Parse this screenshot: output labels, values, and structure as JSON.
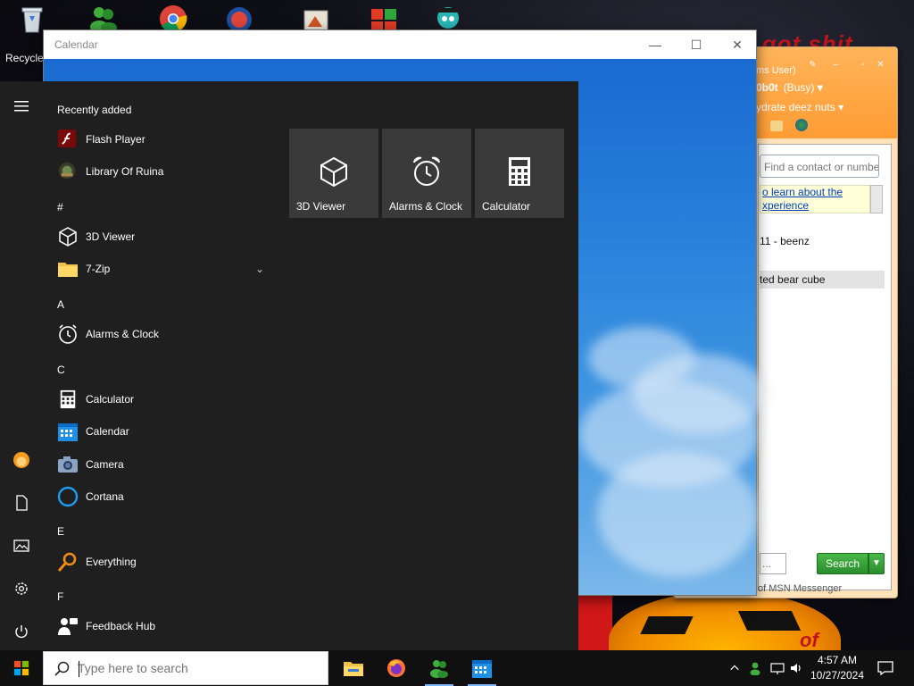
{
  "desktop": {
    "recycle_bin_label": "Recycle",
    "graffiti_text": "e got shit",
    "wallpaper_text": "of"
  },
  "msn": {
    "user_line": "ms User)",
    "name": "0b0t",
    "status": "(Busy)",
    "psm": "ydrate deez nuts",
    "search_placeholder": "Find a contact or numbe",
    "promo_line1": "o learn about the",
    "promo_line2": "xperience",
    "contact_1": "11 - beenz",
    "contact_2": "ted bear cube",
    "search_bottom_placeholder": "...",
    "search_button": "Search",
    "footer": "of MSN Messenger"
  },
  "calendar_window": {
    "title": "Calendar",
    "minimize": "—",
    "maximize": "☐",
    "close": "✕"
  },
  "start_menu": {
    "section_recently_added": "Recently added",
    "recent": [
      {
        "label": "Flash Player",
        "icon": "flash-icon"
      },
      {
        "label": "Library Of Ruina",
        "icon": "library-of-ruina-icon"
      }
    ],
    "groups": {
      "hash": "#",
      "a": "A",
      "c": "C",
      "e": "E",
      "f": "F"
    },
    "apps": {
      "viewer_3d": "3D Viewer",
      "zip": "7-Zip",
      "zip_expand": "⌄",
      "alarms": "Alarms & Clock",
      "calculator": "Calculator",
      "calendar": "Calendar",
      "camera": "Camera",
      "cortana": "Cortana",
      "everything": "Everything",
      "feedback": "Feedback Hub"
    },
    "tiles": [
      {
        "label": "3D Viewer",
        "icon": "cube-icon"
      },
      {
        "label": "Alarms & Clock",
        "icon": "alarm-clock-icon"
      },
      {
        "label": "Calculator",
        "icon": "calculator-icon"
      }
    ]
  },
  "taskbar": {
    "search_placeholder": "Type here to search",
    "apps": [
      "file-explorer-icon",
      "firefox-icon",
      "msn-messenger-icon",
      "calendar-icon"
    ],
    "clock_time": "4:57 AM",
    "clock_date": "10/27/2024"
  },
  "colors": {
    "start_bg": "#1f1f1f",
    "tile_bg": "#3a3a3a",
    "accent_blue": "#2a82dc",
    "msn_orange": "#ff9c33",
    "msn_green": "#2a8d2c"
  }
}
